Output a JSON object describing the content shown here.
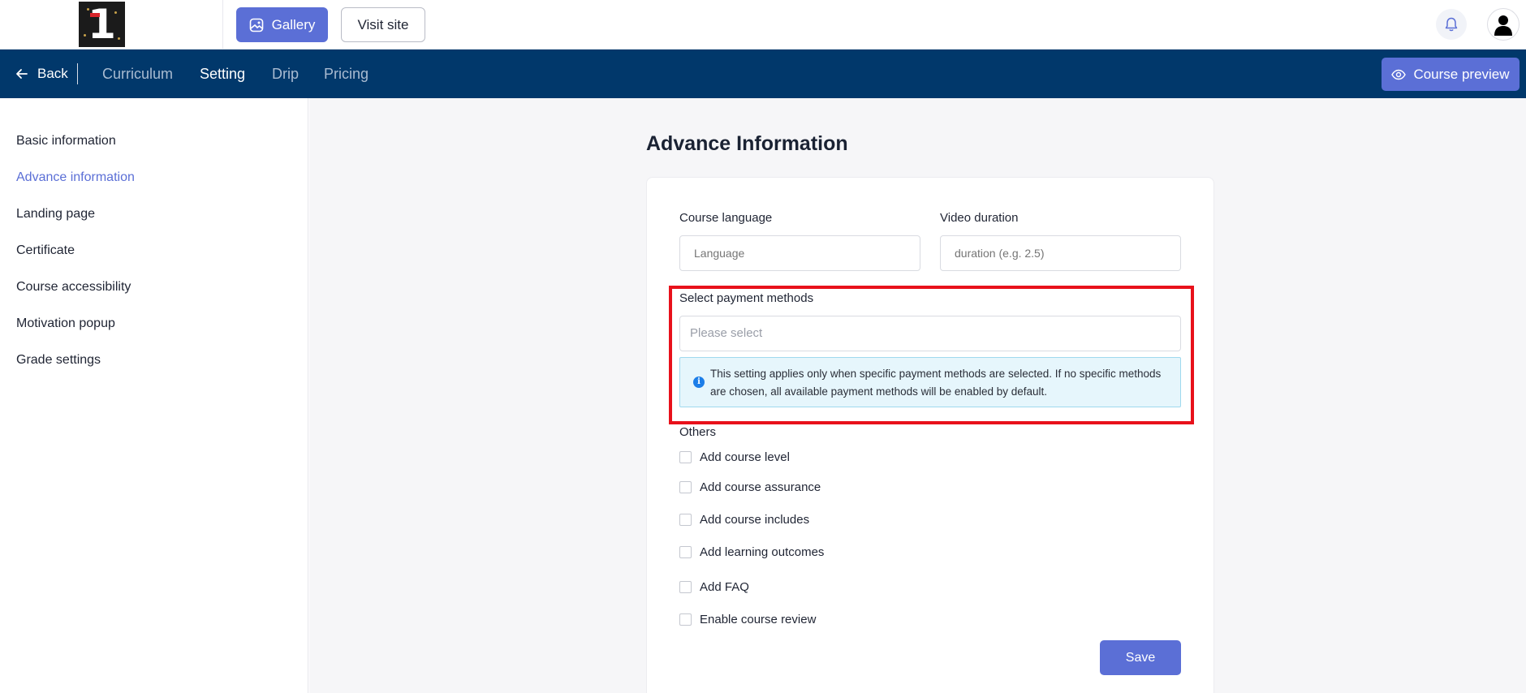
{
  "header": {
    "gallery_label": "Gallery",
    "visit_label": "Visit site"
  },
  "nav": {
    "back_label": "Back",
    "tabs": [
      {
        "label": "Curriculum"
      },
      {
        "label": "Setting"
      },
      {
        "label": "Drip"
      },
      {
        "label": "Pricing"
      }
    ],
    "active_tab": "Setting",
    "preview_label": "Course preview"
  },
  "sidebar": {
    "items": [
      {
        "label": "Basic information"
      },
      {
        "label": "Advance information"
      },
      {
        "label": "Landing page"
      },
      {
        "label": "Certificate"
      },
      {
        "label": "Course accessibility"
      },
      {
        "label": "Motivation popup"
      },
      {
        "label": "Grade settings"
      }
    ],
    "active_item": "Advance information"
  },
  "main": {
    "title": "Advance Information",
    "language": {
      "label": "Course language",
      "placeholder": "Language",
      "value": ""
    },
    "duration": {
      "label": "Video duration",
      "placeholder": "duration (e.g. 2.5)",
      "value": ""
    },
    "payment": {
      "label": "Select payment methods",
      "placeholder": "Please select",
      "info": "This setting applies only when specific payment methods are selected. If no specific methods are chosen, all available payment methods will be enabled by default."
    },
    "others": {
      "label": "Others",
      "options": [
        {
          "label": "Add course level",
          "checked": false
        },
        {
          "label": "Add course assurance",
          "checked": false
        },
        {
          "label": "Add course includes",
          "checked": false
        },
        {
          "label": "Add learning outcomes",
          "checked": false
        },
        {
          "label": "Add FAQ",
          "checked": false
        },
        {
          "label": "Enable course review",
          "checked": false
        }
      ]
    },
    "save_label": "Save"
  },
  "colors": {
    "accent": "#5b6fd6",
    "navbar": "#01386b",
    "highlight": "#e8111b",
    "info_bg": "#e6f6fc"
  }
}
